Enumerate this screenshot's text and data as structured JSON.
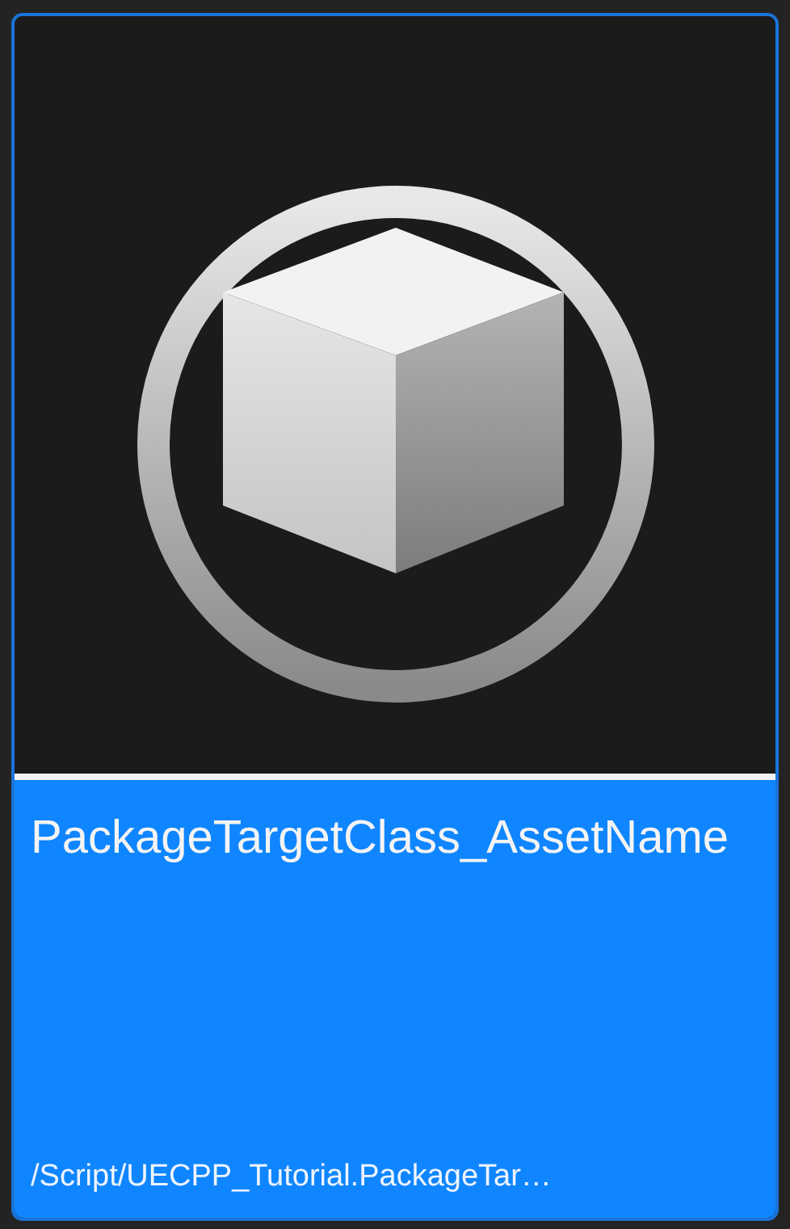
{
  "asset_tile": {
    "selected": true,
    "title": "PackageTargetClass_AssetName",
    "path": "/Script/UECPP_Tutorial.PackageTar…"
  }
}
